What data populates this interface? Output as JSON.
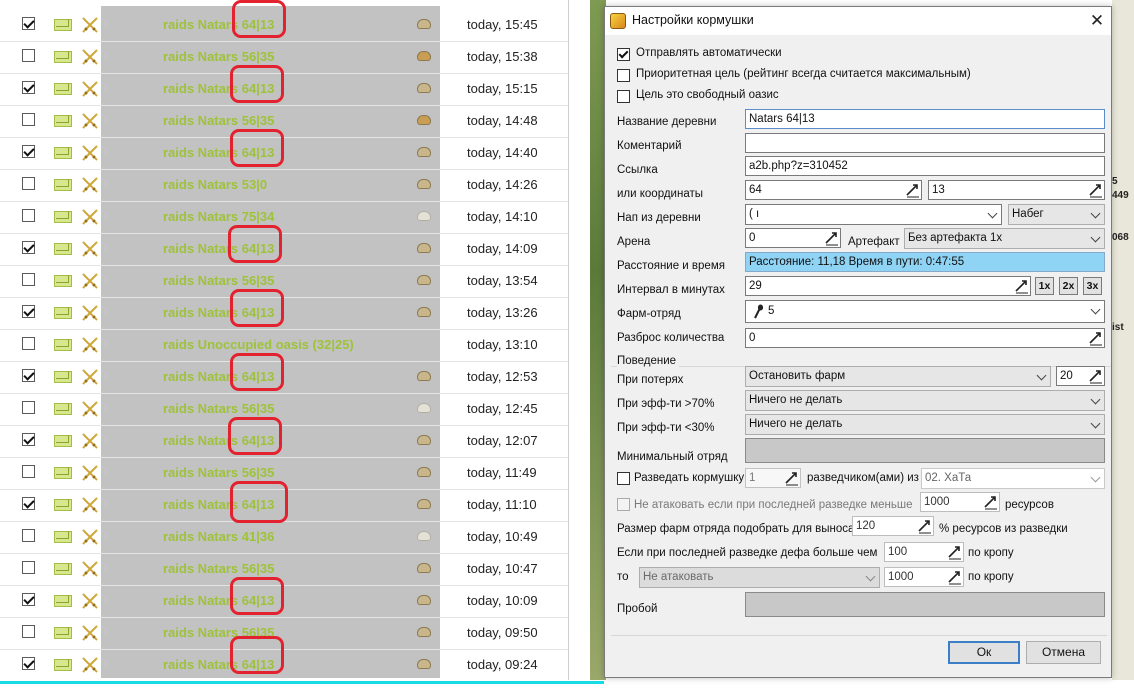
{
  "reports": {
    "rows": [
      {
        "checked": true,
        "subject": "raids Natars 64|13",
        "loot": "full",
        "time": "today, 15:45",
        "marked": true
      },
      {
        "checked": false,
        "subject": "raids Natars 56|35",
        "loot": "partial",
        "time": "today, 15:38",
        "marked": false
      },
      {
        "checked": true,
        "subject": "raids Natars 64|13",
        "loot": "full",
        "time": "today, 15:15",
        "marked": true
      },
      {
        "checked": false,
        "subject": "raids Natars 56|35",
        "loot": "partial",
        "time": "today, 14:48",
        "marked": false
      },
      {
        "checked": true,
        "subject": "raids Natars 64|13",
        "loot": "full",
        "time": "today, 14:40",
        "marked": true
      },
      {
        "checked": false,
        "subject": "raids Natars 53|0",
        "loot": "full",
        "time": "today, 14:26",
        "marked": false
      },
      {
        "checked": false,
        "subject": "raids Natars 75|34",
        "loot": "empty",
        "time": "today, 14:10",
        "marked": false
      },
      {
        "checked": true,
        "subject": "raids Natars 64|13",
        "loot": "full",
        "time": "today, 14:09",
        "marked": true
      },
      {
        "checked": false,
        "subject": "raids Natars 56|35",
        "loot": "full",
        "time": "today, 13:54",
        "marked": false
      },
      {
        "checked": true,
        "subject": "raids Natars 64|13",
        "loot": "full",
        "time": "today, 13:26",
        "marked": true
      },
      {
        "checked": false,
        "subject": "raids Unoccupied oasis (32|25)",
        "loot": "none",
        "time": "today, 13:10",
        "marked": false
      },
      {
        "checked": true,
        "subject": "raids Natars 64|13",
        "loot": "full",
        "time": "today, 12:53",
        "marked": true
      },
      {
        "checked": false,
        "subject": "raids Natars 56|35",
        "loot": "empty",
        "time": "today, 12:45",
        "marked": false
      },
      {
        "checked": true,
        "subject": "raids Natars 64|13",
        "loot": "full",
        "time": "today, 12:07",
        "marked": true
      },
      {
        "checked": false,
        "subject": "raids Natars 56|35",
        "loot": "full",
        "time": "today, 11:49",
        "marked": false
      },
      {
        "checked": true,
        "subject": "raids Natars 64|13",
        "loot": "full",
        "time": "today, 11:10",
        "marked": true
      },
      {
        "checked": false,
        "subject": "raids Natars 41|36",
        "loot": "empty",
        "time": "today, 10:49",
        "marked": false
      },
      {
        "checked": false,
        "subject": "raids Natars 56|35",
        "loot": "full",
        "time": "today, 10:47",
        "marked": false
      },
      {
        "checked": true,
        "subject": "raids Natars 64|13",
        "loot": "full",
        "time": "today, 10:09",
        "marked": true
      },
      {
        "checked": false,
        "subject": "raids Natars 56|35",
        "loot": "full",
        "time": "today, 09:50",
        "marked": false
      },
      {
        "checked": true,
        "subject": "raids Natars 64|13",
        "loot": "full",
        "time": "today, 09:24",
        "marked": true
      }
    ]
  },
  "bg_right": {
    "fragments": [
      "5",
      "449",
      "068",
      "ist"
    ]
  },
  "dialog": {
    "title": "Настройки кормушки",
    "close": "✕",
    "send_auto": {
      "label": "Отправлять автоматически",
      "checked": true
    },
    "priority": {
      "label": "Приоритетная цель (рейтинг всегда считается максимальным)",
      "checked": false
    },
    "free_oasis": {
      "label": "Цель это свободный оазис",
      "checked": false
    },
    "village_name": {
      "label": "Название деревни",
      "value": "Natars 64|13"
    },
    "comment": {
      "label": "Коментарий",
      "value": ""
    },
    "link": {
      "label": "Ссылка",
      "value": "a2b.php?z=310452"
    },
    "coords": {
      "label": "или координаты",
      "x": "64",
      "y": "13"
    },
    "attack_from": {
      "label": "Нап из деревни",
      "village": "( ı",
      "type": "Набег"
    },
    "arena": {
      "label": "Арена",
      "value": "0"
    },
    "artifact": {
      "label": "Артефакт",
      "value": "Без артефакта 1x"
    },
    "distance": {
      "label": "Расстояние и время",
      "value": "Расстояние: 11,18 Время в пути: 0:47:55"
    },
    "interval": {
      "label": "Интервал в минутах",
      "value": "29",
      "mult": [
        "1x",
        "2x",
        "3x"
      ]
    },
    "farm_squad": {
      "label": "Фарм-отряд",
      "value": "5"
    },
    "spread": {
      "label": "Разброс количества",
      "value": "0"
    },
    "behavior": {
      "title": "Поведение",
      "on_loss": {
        "label": "При потерях",
        "value": "Остановить фарм",
        "num": "20"
      },
      "eff_high": {
        "label": "При эфф-ти >70%",
        "value": "Ничего не делать"
      },
      "eff_low": {
        "label": "При эфф-ти <30%",
        "value": "Ничего не делать"
      },
      "min_squad": {
        "label": "Минимальный отряд",
        "value": ""
      },
      "scout": {
        "label": "Разведать кормушку",
        "num": "1",
        "label2": "разведчиком(ами) из",
        "source": "02. ХаТа",
        "checked": false
      },
      "no_attack": {
        "label": "Не атаковать если при последней разведке меньше",
        "num": "1000",
        "unit": "ресурсов",
        "checked": false
      },
      "size_pick": {
        "label": "Размер фарм отряда подобрать для выноса",
        "num": "120",
        "unit": "% ресурсов из разведки"
      },
      "def_more": {
        "label": "Если при последней разведке дефа больше чем",
        "num": "100",
        "unit": "по кропу"
      },
      "then": {
        "label": "то",
        "value": "Не атаковать",
        "num": "1000",
        "unit": "по кропу"
      },
      "breach": {
        "label": "Пробой",
        "value": ""
      }
    },
    "ok": "Ок",
    "cancel": "Отмена"
  }
}
